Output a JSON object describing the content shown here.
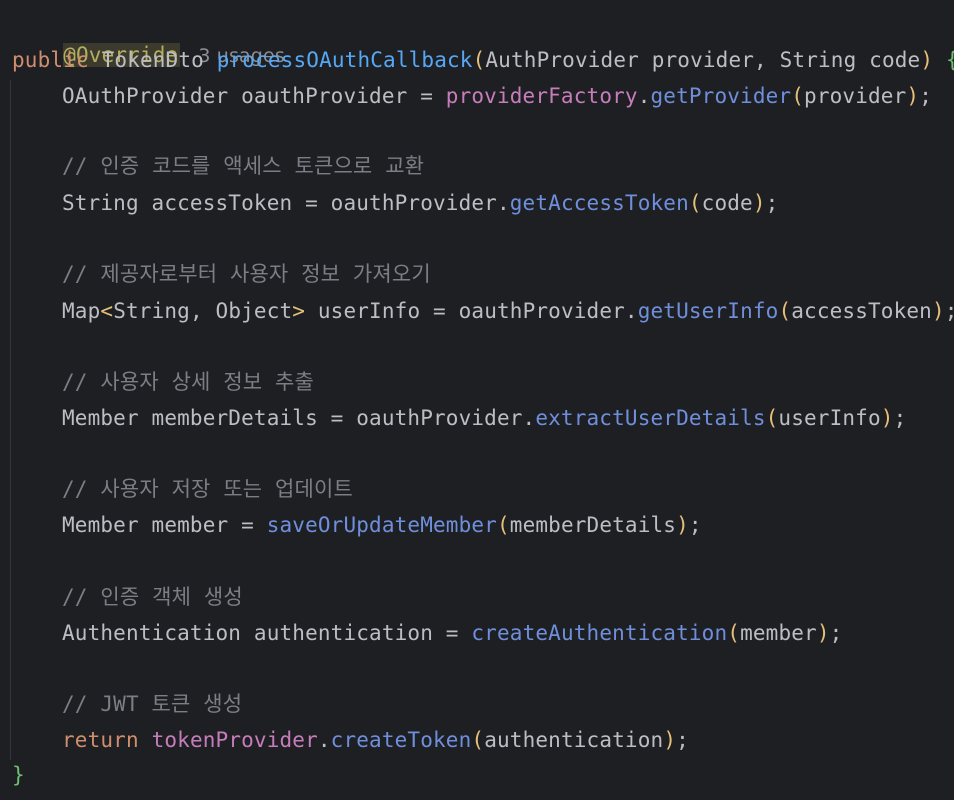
{
  "annotation": "@Override",
  "usages": "3 usages",
  "signature": {
    "kw_public": "public",
    "return_type": "TokenDto",
    "method_name": "processOAuthCallback",
    "paren_open": "(",
    "params": "AuthProvider provider, String code",
    "paren_close": ")",
    "brace_open": "{"
  },
  "line1": {
    "lhs": "OAuthProvider oauthProvider = ",
    "field": "providerFactory",
    "dot": ".",
    "call": "getProvider",
    "po": "(",
    "arg": "provider",
    "pc": ")",
    "semi": ";"
  },
  "comment1": "// 인증 코드를 액세스 토큰으로 교환",
  "line2": {
    "lhs": "String accessToken = oauthProvider.",
    "call": "getAccessToken",
    "po": "(",
    "arg": "code",
    "pc": ")",
    "semi": ";"
  },
  "comment2": "// 제공자로부터 사용자 정보 가져오기",
  "line3": {
    "type_a": "Map",
    "lt": "<",
    "generics": "String, Object",
    "gt": ">",
    "lhs": " userInfo = oauthProvider.",
    "call": "getUserInfo",
    "po": "(",
    "arg": "accessToken",
    "pc": ")",
    "semi": ";"
  },
  "comment3": "// 사용자 상세 정보 추출",
  "line4": {
    "lhs": "Member memberDetails = oauthProvider.",
    "call": "extractUserDetails",
    "po": "(",
    "arg": "userInfo",
    "pc": ")",
    "semi": ";"
  },
  "comment4": "// 사용자 저장 또는 업데이트",
  "line5": {
    "lhs": "Member member = ",
    "call": "saveOrUpdateMember",
    "po": "(",
    "arg": "memberDetails",
    "pc": ")",
    "semi": ";"
  },
  "comment5": "// 인증 객체 생성",
  "line6": {
    "lhs": "Authentication authentication = ",
    "call": "createAuthentication",
    "po": "(",
    "arg": "member",
    "pc": ")",
    "semi": ";"
  },
  "comment6": "// JWT 토큰 생성",
  "line7": {
    "kw": "return",
    "sp": " ",
    "field": "tokenProvider",
    "dot": ".",
    "call": "createToken",
    "po": "(",
    "arg": "authentication",
    "pc": ")",
    "semi": ";"
  },
  "brace_close": "}"
}
